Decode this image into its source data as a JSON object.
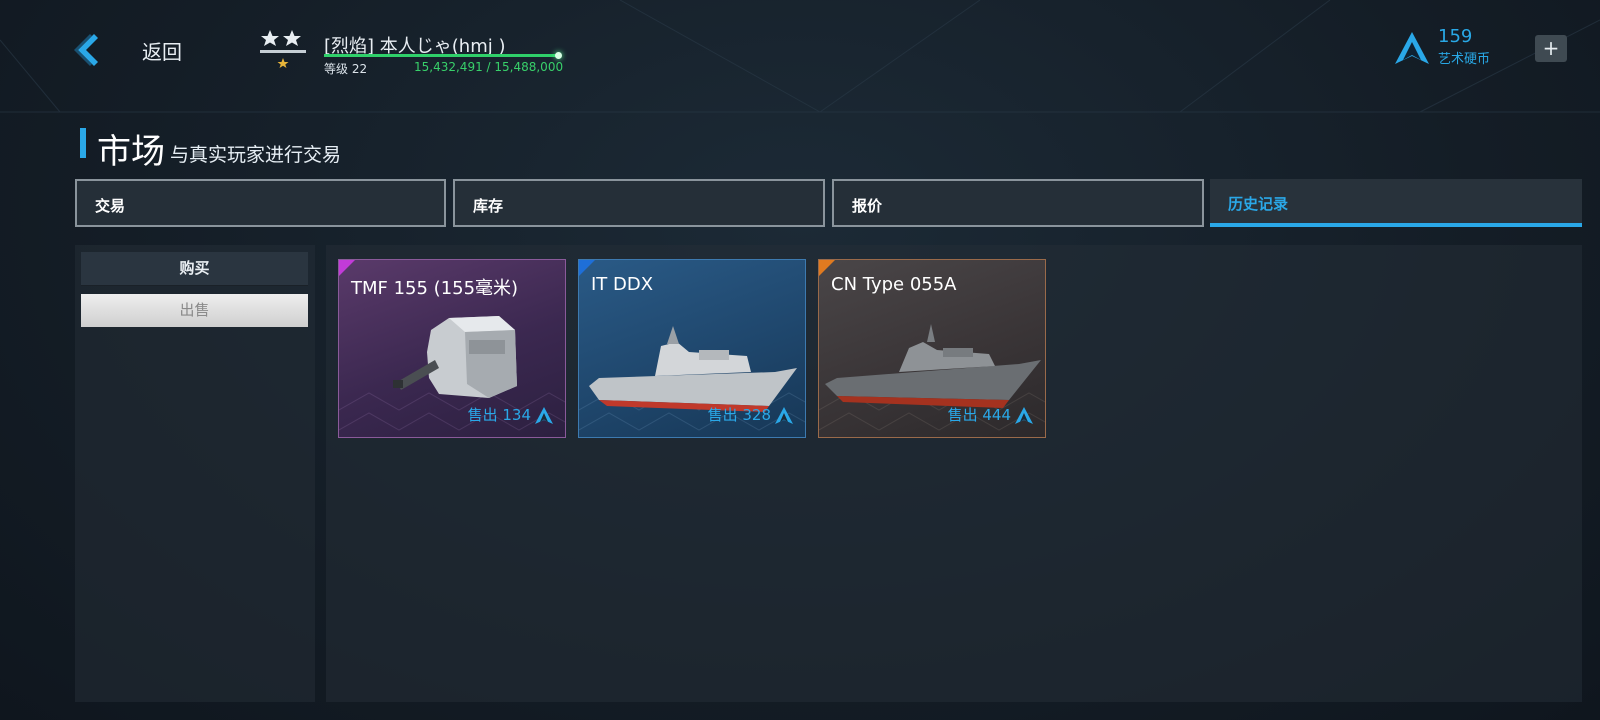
{
  "header": {
    "back_label": "返回",
    "player_name": "[烈焰] 本人じゃ(hmj )",
    "level_label": "等级 22",
    "xp_text": "15,432,491 / 15,488,000",
    "xp_progress": 0.996,
    "currency_amount": "159",
    "currency_label": "艺术硬币",
    "add_label": "+"
  },
  "title": {
    "main": "市场",
    "sub": "与真实玩家进行交易"
  },
  "tabs": [
    {
      "label": "交易"
    },
    {
      "label": "库存"
    },
    {
      "label": "报价"
    },
    {
      "label": "历史记录",
      "active": true
    }
  ],
  "side": {
    "buy_label": "购买",
    "sell_label": "出售",
    "selected": "出售"
  },
  "items": [
    {
      "name": "TMF 155 (155毫米)",
      "price": "售出 134",
      "rarity_color": "#c23bd8",
      "icon": "naval-gun-turret-icon"
    },
    {
      "name": "IT DDX",
      "price": "售出 328",
      "rarity_color": "#1e6fd8",
      "icon": "destroyer-ship-icon"
    },
    {
      "name": "CN Type 055A",
      "price": "售出 444",
      "rarity_color": "#e07a20",
      "icon": "destroyer-ship-icon"
    }
  ],
  "colors": {
    "accent": "#2aa8e8",
    "xp_green": "#38d06a"
  }
}
